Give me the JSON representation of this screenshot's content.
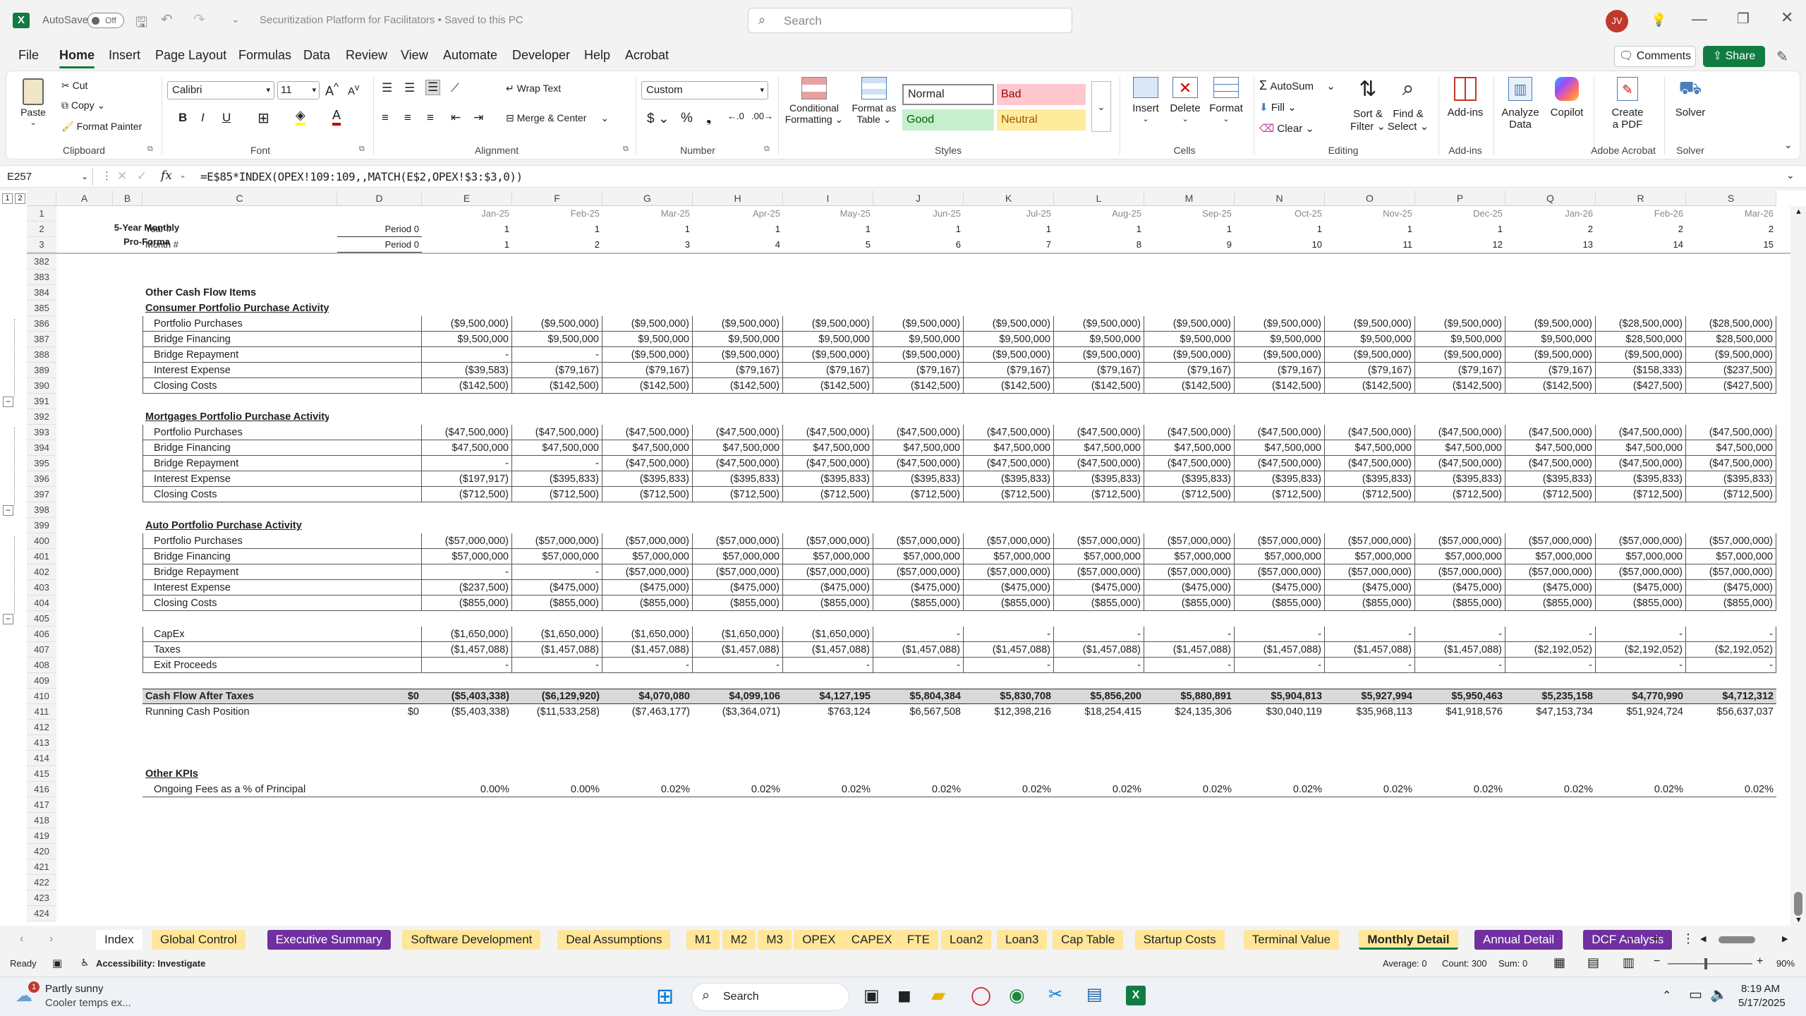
{
  "app": {
    "autosave_label": "AutoSave",
    "autosave_state": "Off",
    "doc_title": "Securitization Platform for Facilitators • Saved to this PC",
    "search_placeholder": "Search",
    "user_initials": "JV"
  },
  "menu_tabs": [
    "File",
    "Home",
    "Insert",
    "Page Layout",
    "Formulas",
    "Data",
    "Review",
    "View",
    "Automate",
    "Developer",
    "Help",
    "Acrobat"
  ],
  "active_tab": "Home",
  "buttons": {
    "comments": "Comments",
    "share": "Share"
  },
  "ribbon": {
    "clipboard": {
      "paste": "Paste",
      "cut": "Cut",
      "copy": "Copy",
      "format_painter": "Format Painter",
      "label": "Clipboard"
    },
    "font": {
      "name": "Calibri",
      "size": "11",
      "label": "Font"
    },
    "alignment": {
      "wrap": "Wrap Text",
      "merge": "Merge & Center",
      "label": "Alignment"
    },
    "number": {
      "format": "Custom",
      "label": "Number"
    },
    "styles": {
      "cond_line1": "Conditional",
      "cond_line2": "Formatting",
      "fmt_line1": "Format as",
      "fmt_line2": "Table",
      "normal": "Normal",
      "bad": "Bad",
      "good": "Good",
      "neutral": "Neutral",
      "label": "Styles"
    },
    "cells": {
      "insert": "Insert",
      "delete": "Delete",
      "format": "Format",
      "label": "Cells"
    },
    "editing": {
      "autosum": "AutoSum",
      "fill": "Fill",
      "clear": "Clear",
      "sort1": "Sort &",
      "sort2": "Filter",
      "find1": "Find &",
      "find2": "Select",
      "label": "Editing"
    },
    "addins": {
      "addins": "Add-ins",
      "label": "Add-ins"
    },
    "analyze": {
      "line1": "Analyze",
      "line2": "Data"
    },
    "copilot": "Copilot",
    "acrobat": {
      "line1": "Create",
      "line2": "a PDF",
      "label": "Adobe Acrobat"
    },
    "solver": {
      "solver": "Solver",
      "label": "Solver"
    }
  },
  "formula_bar": {
    "name_box": "E257",
    "fx": "fx",
    "formula": "=E$85*INDEX(OPEX!109:109,,MATCH(E$2,OPEX!$3:$3,0))"
  },
  "columns": [
    "A",
    "B",
    "C",
    "D",
    "E",
    "F",
    "G",
    "H",
    "I",
    "J",
    "K",
    "L",
    "M",
    "N",
    "O",
    "P",
    "Q",
    "R",
    "S"
  ],
  "frozen": {
    "title1": "5-Year Monthly",
    "title2": "Pro-Forma",
    "row1": [
      "Jan-25",
      "Feb-25",
      "Mar-25",
      "Apr-25",
      "May-25",
      "Jun-25",
      "Jul-25",
      "Aug-25",
      "Sep-25",
      "Oct-25",
      "Nov-25",
      "Dec-25",
      "Jan-26",
      "Feb-26",
      "Mar-26"
    ],
    "year_label": "Year #",
    "period_label": "Period 0",
    "row2": [
      "1",
      "1",
      "1",
      "1",
      "1",
      "1",
      "1",
      "1",
      "1",
      "1",
      "1",
      "1",
      "2",
      "2",
      "2"
    ],
    "month_label": "Month #",
    "row3": [
      "1",
      "2",
      "3",
      "4",
      "5",
      "6",
      "7",
      "8",
      "9",
      "10",
      "11",
      "12",
      "13",
      "14",
      "15"
    ]
  },
  "rows": [
    {
      "n": "382",
      "label": "",
      "vals": []
    },
    {
      "n": "383",
      "label": "",
      "vals": []
    },
    {
      "n": "384",
      "label": "Other Cash Flow Items",
      "style": "bold",
      "vals": []
    },
    {
      "n": "385",
      "label": "Consumer Portfolio Purchase Activity",
      "style": "bu",
      "vals": []
    },
    {
      "n": "386",
      "label": "Portfolio Purchases",
      "style": "ind",
      "box": true,
      "vals": [
        "($9,500,000)",
        "($9,500,000)",
        "($9,500,000)",
        "($9,500,000)",
        "($9,500,000)",
        "($9,500,000)",
        "($9,500,000)",
        "($9,500,000)",
        "($9,500,000)",
        "($9,500,000)",
        "($9,500,000)",
        "($9,500,000)",
        "($9,500,000)",
        "($28,500,000)",
        "($28,500,000)"
      ]
    },
    {
      "n": "387",
      "label": "Bridge Financing",
      "style": "ind",
      "box": true,
      "vals": [
        "$9,500,000",
        "$9,500,000",
        "$9,500,000",
        "$9,500,000",
        "$9,500,000",
        "$9,500,000",
        "$9,500,000",
        "$9,500,000",
        "$9,500,000",
        "$9,500,000",
        "$9,500,000",
        "$9,500,000",
        "$9,500,000",
        "$28,500,000",
        "$28,500,000"
      ]
    },
    {
      "n": "388",
      "label": "Bridge Repayment",
      "style": "ind",
      "box": true,
      "vals": [
        "-",
        "-",
        "($9,500,000)",
        "($9,500,000)",
        "($9,500,000)",
        "($9,500,000)",
        "($9,500,000)",
        "($9,500,000)",
        "($9,500,000)",
        "($9,500,000)",
        "($9,500,000)",
        "($9,500,000)",
        "($9,500,000)",
        "($9,500,000)",
        "($9,500,000)"
      ]
    },
    {
      "n": "389",
      "label": "Interest Expense",
      "style": "ind",
      "box": true,
      "vals": [
        "($39,583)",
        "($79,167)",
        "($79,167)",
        "($79,167)",
        "($79,167)",
        "($79,167)",
        "($79,167)",
        "($79,167)",
        "($79,167)",
        "($79,167)",
        "($79,167)",
        "($79,167)",
        "($79,167)",
        "($158,333)",
        "($237,500)"
      ]
    },
    {
      "n": "390",
      "label": "Closing Costs",
      "style": "ind",
      "box": true,
      "vals": [
        "($142,500)",
        "($142,500)",
        "($142,500)",
        "($142,500)",
        "($142,500)",
        "($142,500)",
        "($142,500)",
        "($142,500)",
        "($142,500)",
        "($142,500)",
        "($142,500)",
        "($142,500)",
        "($142,500)",
        "($427,500)",
        "($427,500)"
      ]
    },
    {
      "n": "391",
      "label": "",
      "vals": []
    },
    {
      "n": "392",
      "label": "Mortgages Portfolio Purchase Activity",
      "style": "bu",
      "vals": []
    },
    {
      "n": "393",
      "label": "Portfolio Purchases",
      "style": "ind",
      "box": true,
      "vals": [
        "($47,500,000)",
        "($47,500,000)",
        "($47,500,000)",
        "($47,500,000)",
        "($47,500,000)",
        "($47,500,000)",
        "($47,500,000)",
        "($47,500,000)",
        "($47,500,000)",
        "($47,500,000)",
        "($47,500,000)",
        "($47,500,000)",
        "($47,500,000)",
        "($47,500,000)",
        "($47,500,000)"
      ]
    },
    {
      "n": "394",
      "label": "Bridge Financing",
      "style": "ind",
      "box": true,
      "vals": [
        "$47,500,000",
        "$47,500,000",
        "$47,500,000",
        "$47,500,000",
        "$47,500,000",
        "$47,500,000",
        "$47,500,000",
        "$47,500,000",
        "$47,500,000",
        "$47,500,000",
        "$47,500,000",
        "$47,500,000",
        "$47,500,000",
        "$47,500,000",
        "$47,500,000"
      ]
    },
    {
      "n": "395",
      "label": "Bridge Repayment",
      "style": "ind",
      "box": true,
      "vals": [
        "-",
        "-",
        "($47,500,000)",
        "($47,500,000)",
        "($47,500,000)",
        "($47,500,000)",
        "($47,500,000)",
        "($47,500,000)",
        "($47,500,000)",
        "($47,500,000)",
        "($47,500,000)",
        "($47,500,000)",
        "($47,500,000)",
        "($47,500,000)",
        "($47,500,000)"
      ]
    },
    {
      "n": "396",
      "label": "Interest Expense",
      "style": "ind",
      "box": true,
      "vals": [
        "($197,917)",
        "($395,833)",
        "($395,833)",
        "($395,833)",
        "($395,833)",
        "($395,833)",
        "($395,833)",
        "($395,833)",
        "($395,833)",
        "($395,833)",
        "($395,833)",
        "($395,833)",
        "($395,833)",
        "($395,833)",
        "($395,833)"
      ]
    },
    {
      "n": "397",
      "label": "Closing Costs",
      "style": "ind",
      "box": true,
      "vals": [
        "($712,500)",
        "($712,500)",
        "($712,500)",
        "($712,500)",
        "($712,500)",
        "($712,500)",
        "($712,500)",
        "($712,500)",
        "($712,500)",
        "($712,500)",
        "($712,500)",
        "($712,500)",
        "($712,500)",
        "($712,500)",
        "($712,500)"
      ]
    },
    {
      "n": "398",
      "label": "",
      "vals": []
    },
    {
      "n": "399",
      "label": "Auto Portfolio Purchase Activity",
      "style": "bu",
      "vals": []
    },
    {
      "n": "400",
      "label": "Portfolio Purchases",
      "style": "ind",
      "box": true,
      "vals": [
        "($57,000,000)",
        "($57,000,000)",
        "($57,000,000)",
        "($57,000,000)",
        "($57,000,000)",
        "($57,000,000)",
        "($57,000,000)",
        "($57,000,000)",
        "($57,000,000)",
        "($57,000,000)",
        "($57,000,000)",
        "($57,000,000)",
        "($57,000,000)",
        "($57,000,000)",
        "($57,000,000)"
      ]
    },
    {
      "n": "401",
      "label": "Bridge Financing",
      "style": "ind",
      "box": true,
      "vals": [
        "$57,000,000",
        "$57,000,000",
        "$57,000,000",
        "$57,000,000",
        "$57,000,000",
        "$57,000,000",
        "$57,000,000",
        "$57,000,000",
        "$57,000,000",
        "$57,000,000",
        "$57,000,000",
        "$57,000,000",
        "$57,000,000",
        "$57,000,000",
        "$57,000,000"
      ]
    },
    {
      "n": "402",
      "label": "Bridge Repayment",
      "style": "ind",
      "box": true,
      "vals": [
        "-",
        "-",
        "($57,000,000)",
        "($57,000,000)",
        "($57,000,000)",
        "($57,000,000)",
        "($57,000,000)",
        "($57,000,000)",
        "($57,000,000)",
        "($57,000,000)",
        "($57,000,000)",
        "($57,000,000)",
        "($57,000,000)",
        "($57,000,000)",
        "($57,000,000)"
      ]
    },
    {
      "n": "403",
      "label": "Interest Expense",
      "style": "ind",
      "box": true,
      "vals": [
        "($237,500)",
        "($475,000)",
        "($475,000)",
        "($475,000)",
        "($475,000)",
        "($475,000)",
        "($475,000)",
        "($475,000)",
        "($475,000)",
        "($475,000)",
        "($475,000)",
        "($475,000)",
        "($475,000)",
        "($475,000)",
        "($475,000)"
      ]
    },
    {
      "n": "404",
      "label": "Closing Costs",
      "style": "ind",
      "box": true,
      "vals": [
        "($855,000)",
        "($855,000)",
        "($855,000)",
        "($855,000)",
        "($855,000)",
        "($855,000)",
        "($855,000)",
        "($855,000)",
        "($855,000)",
        "($855,000)",
        "($855,000)",
        "($855,000)",
        "($855,000)",
        "($855,000)",
        "($855,000)"
      ]
    },
    {
      "n": "405",
      "label": "",
      "vals": []
    },
    {
      "n": "406",
      "label": "CapEx",
      "style": "ind",
      "box": true,
      "vals": [
        "($1,650,000)",
        "($1,650,000)",
        "($1,650,000)",
        "($1,650,000)",
        "($1,650,000)",
        "-",
        "-",
        "-",
        "-",
        "-",
        "-",
        "-",
        "-",
        "-",
        "-"
      ]
    },
    {
      "n": "407",
      "label": "Taxes",
      "style": "ind",
      "box": true,
      "vals": [
        "($1,457,088)",
        "($1,457,088)",
        "($1,457,088)",
        "($1,457,088)",
        "($1,457,088)",
        "($1,457,088)",
        "($1,457,088)",
        "($1,457,088)",
        "($1,457,088)",
        "($1,457,088)",
        "($1,457,088)",
        "($1,457,088)",
        "($2,192,052)",
        "($2,192,052)",
        "($2,192,052)"
      ]
    },
    {
      "n": "408",
      "label": "Exit Proceeds",
      "style": "ind",
      "box": true,
      "vals": [
        "-",
        "-",
        "-",
        "-",
        "-",
        "-",
        "-",
        "-",
        "-",
        "-",
        "-",
        "-",
        "-",
        "-",
        "-"
      ]
    },
    {
      "n": "409",
      "label": "",
      "vals": []
    },
    {
      "n": "410",
      "label": "Cash Flow After Taxes",
      "style": "total",
      "d": "$0",
      "vals": [
        "($5,403,338)",
        "($6,129,920)",
        "$4,070,080",
        "$4,099,106",
        "$4,127,195",
        "$5,804,384",
        "$5,830,708",
        "$5,856,200",
        "$5,880,891",
        "$5,904,813",
        "$5,927,994",
        "$5,950,463",
        "$5,235,158",
        "$4,770,990",
        "$4,712,312"
      ]
    },
    {
      "n": "411",
      "label": "Running Cash Position",
      "style": "plain",
      "d": "$0",
      "vals": [
        "($5,403,338)",
        "($11,533,258)",
        "($7,463,177)",
        "($3,364,071)",
        "$763,124",
        "$6,567,508",
        "$12,398,216",
        "$18,254,415",
        "$24,135,306",
        "$30,040,119",
        "$35,968,113",
        "$41,918,576",
        "$47,153,734",
        "$51,924,724",
        "$56,637,037"
      ]
    },
    {
      "n": "412",
      "label": "",
      "vals": []
    },
    {
      "n": "413",
      "label": "",
      "vals": []
    },
    {
      "n": "414",
      "label": "",
      "vals": []
    },
    {
      "n": "415",
      "label": "Other KPIs",
      "style": "bu",
      "vals": []
    },
    {
      "n": "416",
      "label": "Ongoing Fees as a % of Principal",
      "style": "indline",
      "vals": [
        "0.00%",
        "0.00%",
        "0.02%",
        "0.02%",
        "0.02%",
        "0.02%",
        "0.02%",
        "0.02%",
        "0.02%",
        "0.02%",
        "0.02%",
        "0.02%",
        "0.02%",
        "0.02%",
        "0.02%"
      ]
    },
    {
      "n": "417",
      "label": "",
      "vals": []
    },
    {
      "n": "418",
      "label": "",
      "vals": []
    },
    {
      "n": "419",
      "label": "",
      "vals": []
    },
    {
      "n": "420",
      "label": "",
      "vals": []
    },
    {
      "n": "421",
      "label": "",
      "vals": []
    },
    {
      "n": "422",
      "label": "",
      "vals": []
    },
    {
      "n": "423",
      "label": "",
      "vals": []
    },
    {
      "n": "424",
      "label": "",
      "vals": []
    }
  ],
  "sheet_tabs": [
    {
      "name": "Index",
      "bg": "#ffffff",
      "fg": "#222222"
    },
    {
      "name": "Global Control",
      "bg": "#ffe699",
      "fg": "#222222"
    },
    {
      "name": "Executive Summary",
      "bg": "#7030a0",
      "fg": "#ffffff"
    },
    {
      "name": "Software Development",
      "bg": "#ffe699",
      "fg": "#222222"
    },
    {
      "name": "Deal Assumptions",
      "bg": "#ffe699",
      "fg": "#222222"
    },
    {
      "name": "M1",
      "bg": "#ffe699",
      "fg": "#222222"
    },
    {
      "name": "M2",
      "bg": "#ffe699",
      "fg": "#222222"
    },
    {
      "name": "M3",
      "bg": "#ffe699",
      "fg": "#222222"
    },
    {
      "name": "OPEX",
      "bg": "#ffe699",
      "fg": "#222222"
    },
    {
      "name": "CAPEX",
      "bg": "#ffe699",
      "fg": "#222222"
    },
    {
      "name": "FTE",
      "bg": "#ffe699",
      "fg": "#222222"
    },
    {
      "name": "Loan2",
      "bg": "#ffe699",
      "fg": "#222222"
    },
    {
      "name": "Loan3",
      "bg": "#ffe699",
      "fg": "#222222"
    },
    {
      "name": "Cap Table",
      "bg": "#ffe699",
      "fg": "#222222"
    },
    {
      "name": "Startup Costs",
      "bg": "#ffe699",
      "fg": "#222222"
    },
    {
      "name": "Terminal Value",
      "bg": "#ffe699",
      "fg": "#222222"
    },
    {
      "name": "Monthly Detail",
      "bg": "#ffe699",
      "fg": "#222222",
      "active": true
    },
    {
      "name": "Annual Detail",
      "bg": "#7030a0",
      "fg": "#ffffff"
    },
    {
      "name": "DCF Analysis",
      "bg": "#7030a0",
      "fg": "#ffffff"
    }
  ],
  "status": {
    "ready": "Ready",
    "accessibility": "Accessibility: Investigate",
    "average": "Average: 0",
    "count": "Count: 300",
    "sum": "Sum: 0",
    "zoom": "90%"
  },
  "taskbar": {
    "weather1": "Partly sunny",
    "weather2": "Cooler temps ex...",
    "search": "Search",
    "time": "8:19 AM",
    "date": "5/17/2025"
  },
  "colors": {
    "excel_green": "#107c41",
    "purple_tab": "#7030a0",
    "yellow_tab": "#ffe699"
  }
}
